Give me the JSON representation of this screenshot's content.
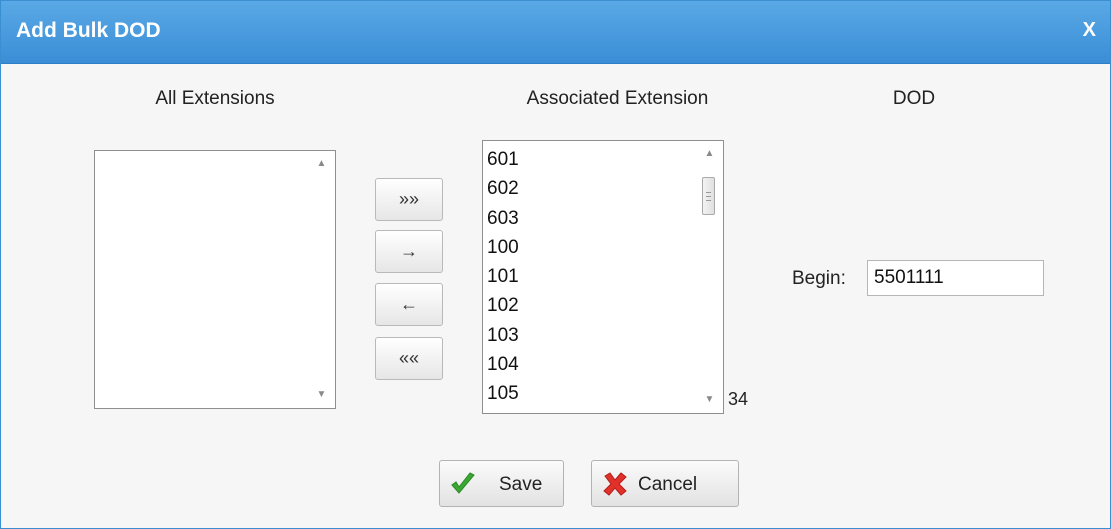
{
  "dialog": {
    "title": "Add Bulk DOD",
    "close_label": "X"
  },
  "columns": {
    "all_extensions": "All Extensions",
    "associated_extension": "Associated Extension",
    "dod": "DOD"
  },
  "all_extensions": {
    "items": []
  },
  "associated_extensions": {
    "items": [
      "601",
      "602",
      "603",
      "100",
      "101",
      "102",
      "103",
      "104",
      "105"
    ],
    "count": "34"
  },
  "move_buttons": {
    "add_all": "»»",
    "add_one": "→",
    "remove_one": "←",
    "remove_all": "««"
  },
  "dod": {
    "begin_label": "Begin:",
    "begin_value": "5501111"
  },
  "actions": {
    "save_label": "Save",
    "cancel_label": "Cancel"
  },
  "colors": {
    "titlebar": "#3a8ed6",
    "save_check": "#3aa832",
    "cancel_x": "#e2302a"
  },
  "icons": [
    "close-icon",
    "checkmark-icon",
    "cancel-x-icon",
    "scroll-up-icon",
    "scroll-down-icon"
  ]
}
